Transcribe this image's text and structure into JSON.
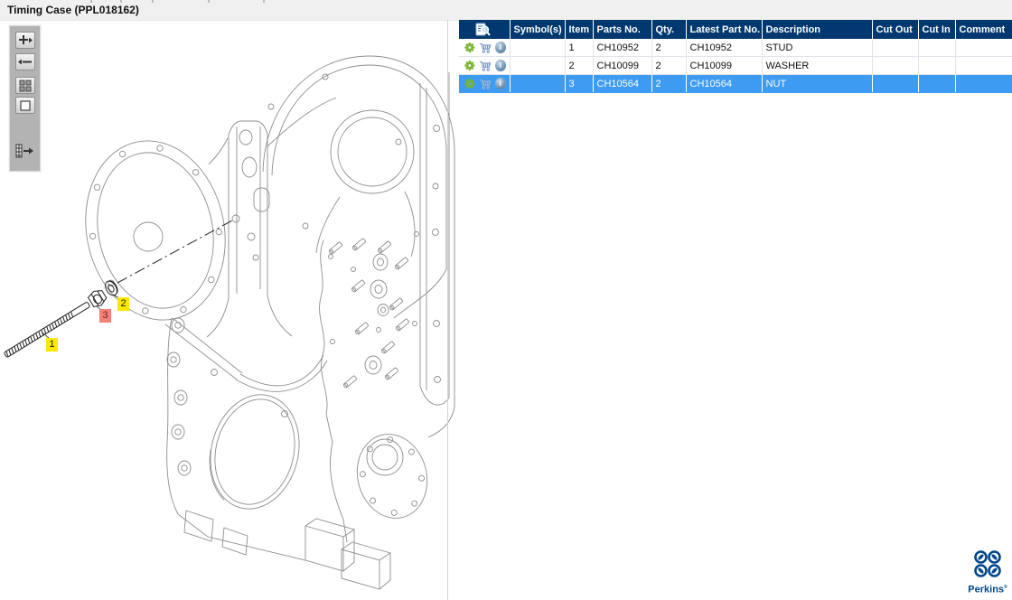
{
  "window": {
    "title": "Timing Case (PPL018162)"
  },
  "toolbar": {
    "buttons": [
      {
        "name": "zoom-in",
        "icon": "plus-arrow-icon"
      },
      {
        "name": "zoom-out",
        "icon": "minus-arrow-icon"
      },
      {
        "name": "fit-view",
        "icon": "four-squares-icon"
      },
      {
        "name": "actual-size",
        "icon": "square-icon"
      },
      {
        "name": "toggle-parts-list",
        "icon": "list-arrow-icon"
      }
    ]
  },
  "diagram": {
    "callouts": [
      {
        "label": "1",
        "highlight": "yellow"
      },
      {
        "label": "2",
        "highlight": "yellow"
      },
      {
        "label": "3",
        "highlight": "red"
      }
    ]
  },
  "table": {
    "columns": [
      {
        "label": ""
      },
      {
        "label": "Symbol(s)"
      },
      {
        "label": "Item"
      },
      {
        "label": "Parts No."
      },
      {
        "label": "Qty."
      },
      {
        "label": "Latest Part No."
      },
      {
        "label": "Description"
      },
      {
        "label": "Cut Out"
      },
      {
        "label": "Cut In"
      },
      {
        "label": "Comment"
      }
    ],
    "rows": [
      {
        "symbol": "",
        "item": "1",
        "parts_no": "CH10952",
        "qty": "2",
        "latest_part_no": "CH10952",
        "description": "STUD",
        "cut_out": "",
        "cut_in": "",
        "comment": "",
        "selected": false
      },
      {
        "symbol": "",
        "item": "2",
        "parts_no": "CH10099",
        "qty": "2",
        "latest_part_no": "CH10099",
        "description": "WASHER",
        "cut_out": "",
        "cut_in": "",
        "comment": "",
        "selected": false
      },
      {
        "symbol": "",
        "item": "3",
        "parts_no": "CH10564",
        "qty": "2",
        "latest_part_no": "CH10564",
        "description": "NUT",
        "cut_out": "",
        "cut_in": "",
        "comment": "",
        "selected": true
      }
    ]
  },
  "branding": {
    "logo_text": "Perkins",
    "mark": "®"
  },
  "colors": {
    "header_bg": "#00386F",
    "selected_row": "#3E9BF2",
    "callout_yellow": "#FFE800",
    "callout_red": "#F48178",
    "perkins_blue": "#00468B",
    "gear_green": "#79B42E"
  }
}
